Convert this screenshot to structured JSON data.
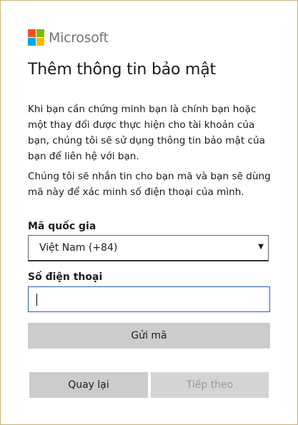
{
  "brand": {
    "name": "Microsoft",
    "colors": [
      "#f25022",
      "#7fba00",
      "#00a4ef",
      "#ffb900"
    ]
  },
  "title": "Thêm thông tin bảo mật",
  "paragraphs": {
    "intro": "Khi bạn cần chứng minh bạn là chính bạn hoặc một thay đổi được thực hiện cho tài khoản của bạn, chúng tôi sẽ sử dụng thông tin bảo mật của bạn để liên hệ với bạn.",
    "sms": "Chúng tôi sẽ nhắn tin cho bạn mã và bạn sẽ dùng mã này để xác minh số điện thoại của mình."
  },
  "country": {
    "label": "Mã quốc gia",
    "selected": "Việt Nam (+84)"
  },
  "phone": {
    "label": "Số điện thoại",
    "value": ""
  },
  "buttons": {
    "send_code": "Gửi mã",
    "back": "Quay lại",
    "next": "Tiếp theo"
  }
}
